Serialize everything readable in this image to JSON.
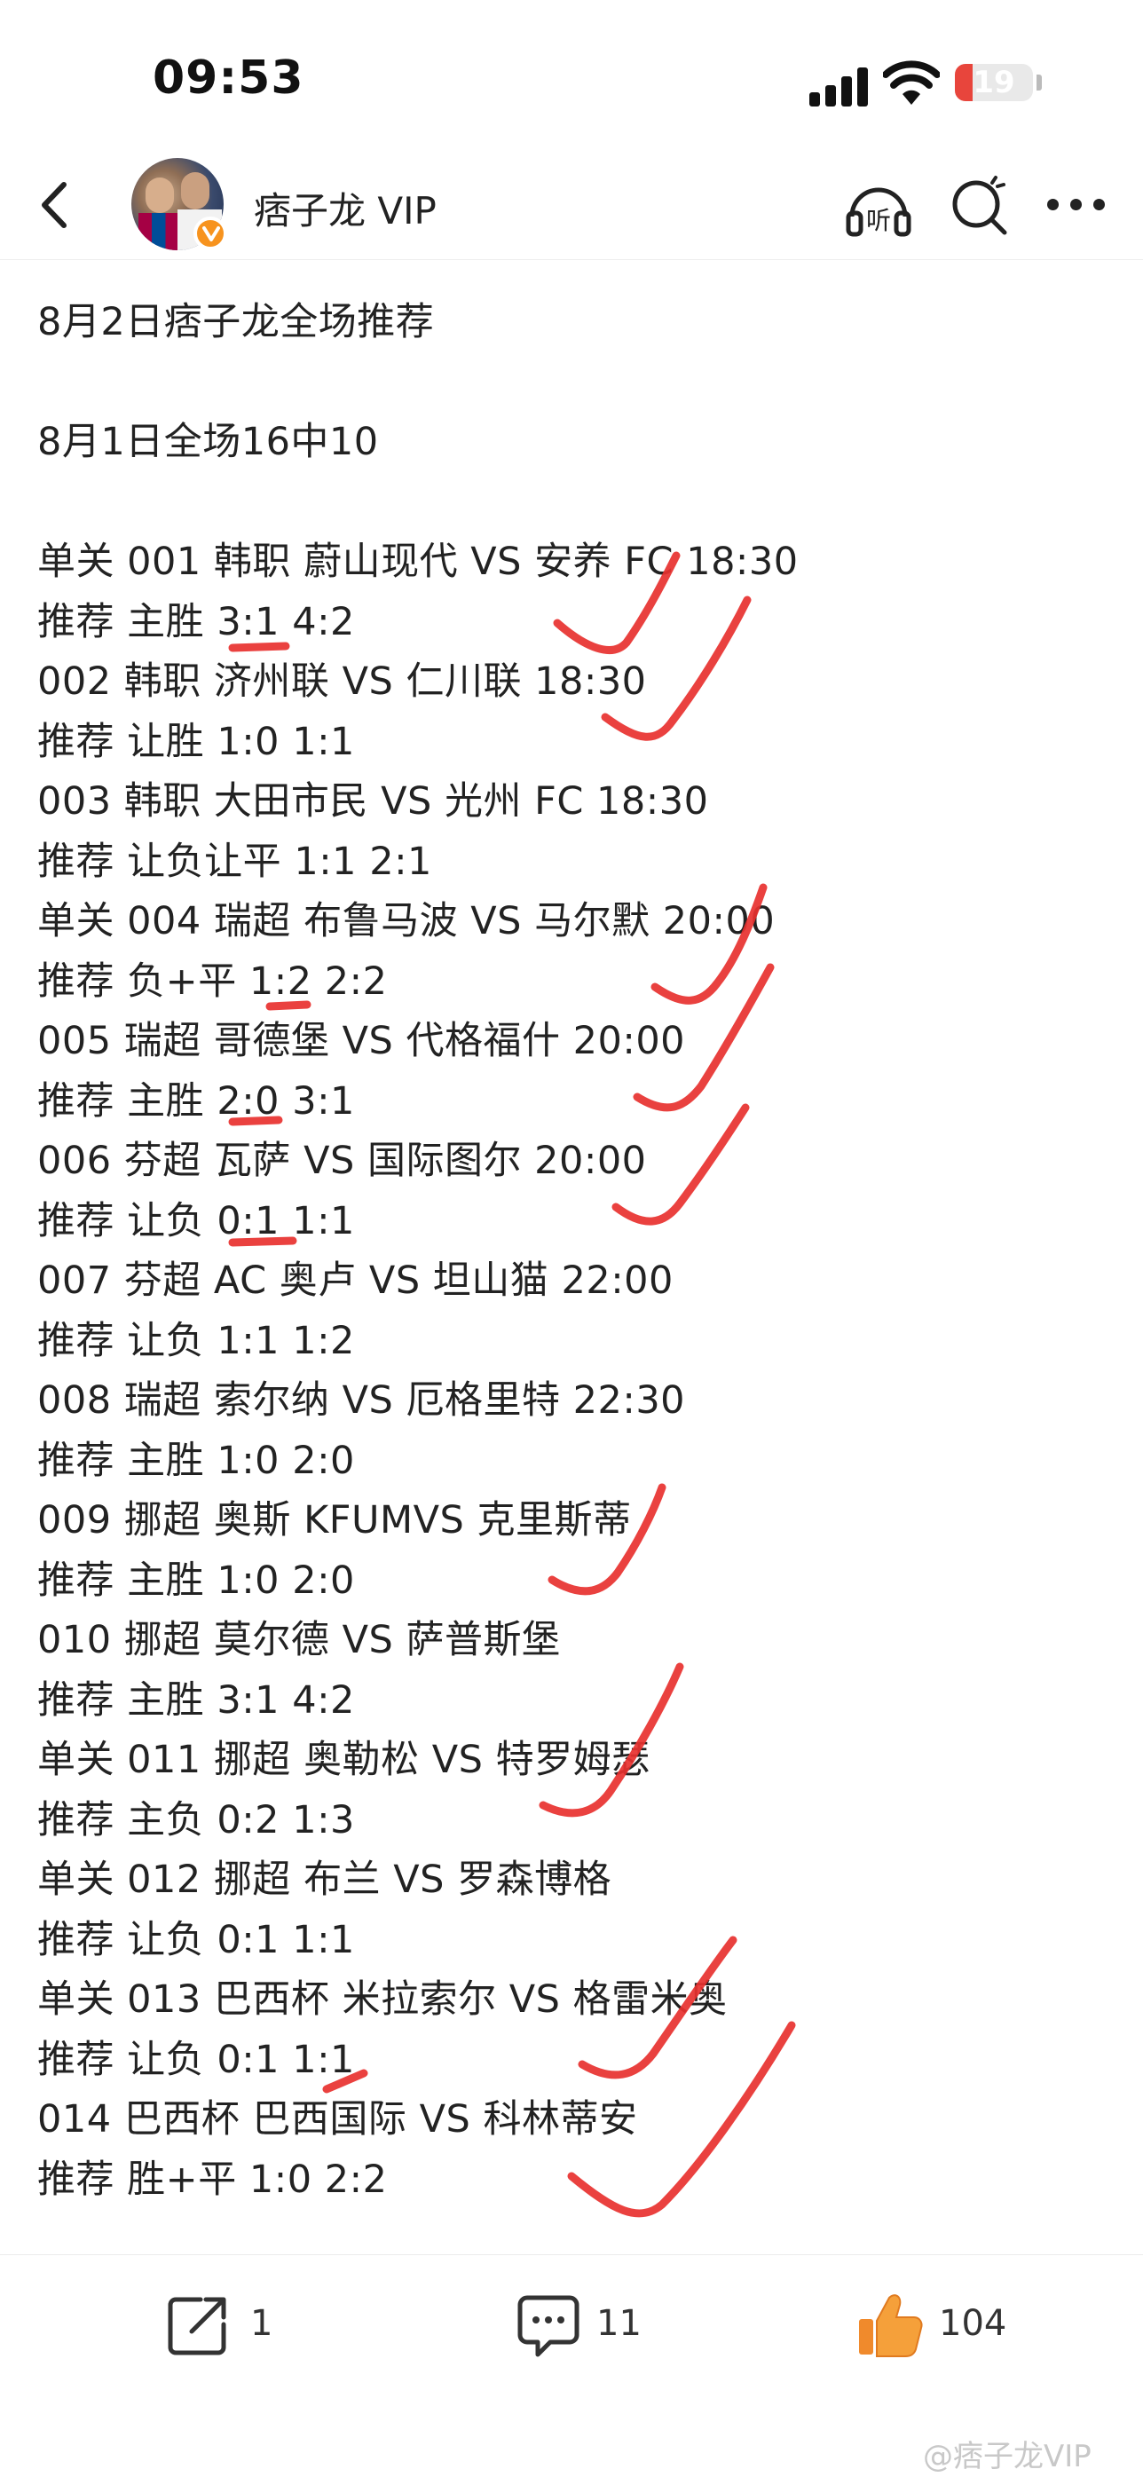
{
  "status": {
    "time": "09:53",
    "battery": "19"
  },
  "nav": {
    "title": "痞子龙 VIP",
    "listen_label": "听"
  },
  "post": {
    "heading": "8月2日痞子龙全场推荐",
    "record": "8月1日全场16中10",
    "lines": [
      "单关 001 韩职 蔚山现代 VS 安养 FC 18:30",
      "推荐 主胜 3:1 4:2",
      "002 韩职 济州联 VS 仁川联 18:30",
      "推荐 让胜 1:0 1:1",
      "003 韩职 大田市民 VS 光州 FC 18:30",
      "推荐 让负让平 1:1 2:1",
      "单关 004 瑞超 布鲁马波 VS 马尔默 20:00",
      "推荐 负+平 1:2 2:2",
      "005 瑞超 哥德堡 VS 代格福什 20:00",
      "推荐 主胜 2:0 3:1",
      "006 芬超 瓦萨 VS 国际图尔 20:00",
      "推荐 让负 0:1 1:1",
      "007 芬超 AC 奥卢 VS 坦山猫 22:00",
      "推荐 让负 1:1 1:2",
      "008 瑞超 索尔纳 VS 厄格里特 22:30",
      "推荐 主胜 1:0 2:0",
      "009 挪超 奥斯 KFUMVS 克里斯蒂",
      "推荐 主胜 1:0 2:0",
      "010 挪超 莫尔德 VS 萨普斯堡",
      "推荐 主胜 3:1 4:2",
      "单关 011 挪超 奥勒松 VS 特罗姆瑟",
      "推荐 主负 0:2 1:3",
      "单关 012 挪超 布兰 VS 罗森博格",
      "推荐 让负 0:1 1:1",
      "单关 013 巴西杯 米拉索尔 VS 格雷米奥",
      "推荐 让负 0:1 1:1",
      "014 巴西杯 巴西国际 VS 科林蒂安",
      "推荐 胜+平 1:0 2:2"
    ]
  },
  "actions": {
    "share_count": "1",
    "comment_count": "11",
    "like_count": "104"
  },
  "watermark": "@痞子龙VIP",
  "colors": {
    "check_marks": "#e8312f",
    "like_icon": "#f08a2c",
    "battery": "#e8453c",
    "badge": "#f7931e"
  }
}
